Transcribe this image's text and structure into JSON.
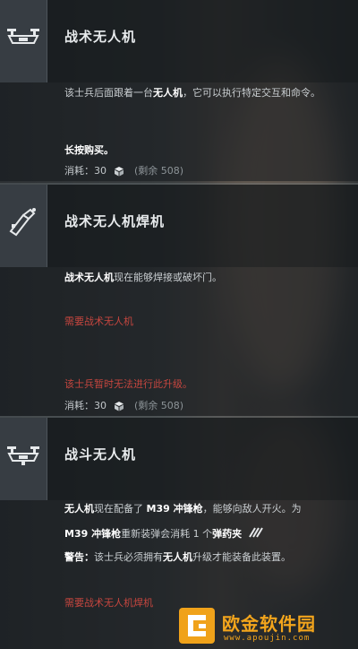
{
  "section1": {
    "title": "战术无人机",
    "desc_pre": "该士兵后面跟着一台",
    "desc_bold": "无人机",
    "desc_post": "，它可以执行特定交互和命令。",
    "hint": "长按购买。",
    "cost_label": "消耗：30",
    "remaining": "(剩余 508)"
  },
  "section2": {
    "title": "战术无人机焊机",
    "desc_bold": "战术无人机",
    "desc_post": "现在能够焊接或破坏门。",
    "requirement": "需要战术无人机",
    "warning": "该士兵暂时无法进行此升级。",
    "cost_label": "消耗：30",
    "remaining": "(剩余 508)"
  },
  "section3": {
    "title": "战斗无人机",
    "l1_b1": "无人机",
    "l1_t1": "现在配备了 ",
    "l1_b2": "M39 冲锋枪",
    "l1_t2": "，能够向敌人开火。为",
    "l2_b1": "M39 冲锋枪",
    "l2_t1": "重新装弹会消耗 1 个",
    "l2_b2": "弹药夹",
    "l3_b1": "警告：",
    "l3_t1": "该士兵必须拥有",
    "l3_b2": "无人机",
    "l3_t2": "升级才能装备此装置。",
    "requirement": "需要战术无人机焊机"
  },
  "watermark": {
    "name": "欧金软件园",
    "url": "www.apoujin.com"
  },
  "colors": {
    "accent_red": "#c6463f",
    "watermark_orange": "#f0a21a"
  }
}
